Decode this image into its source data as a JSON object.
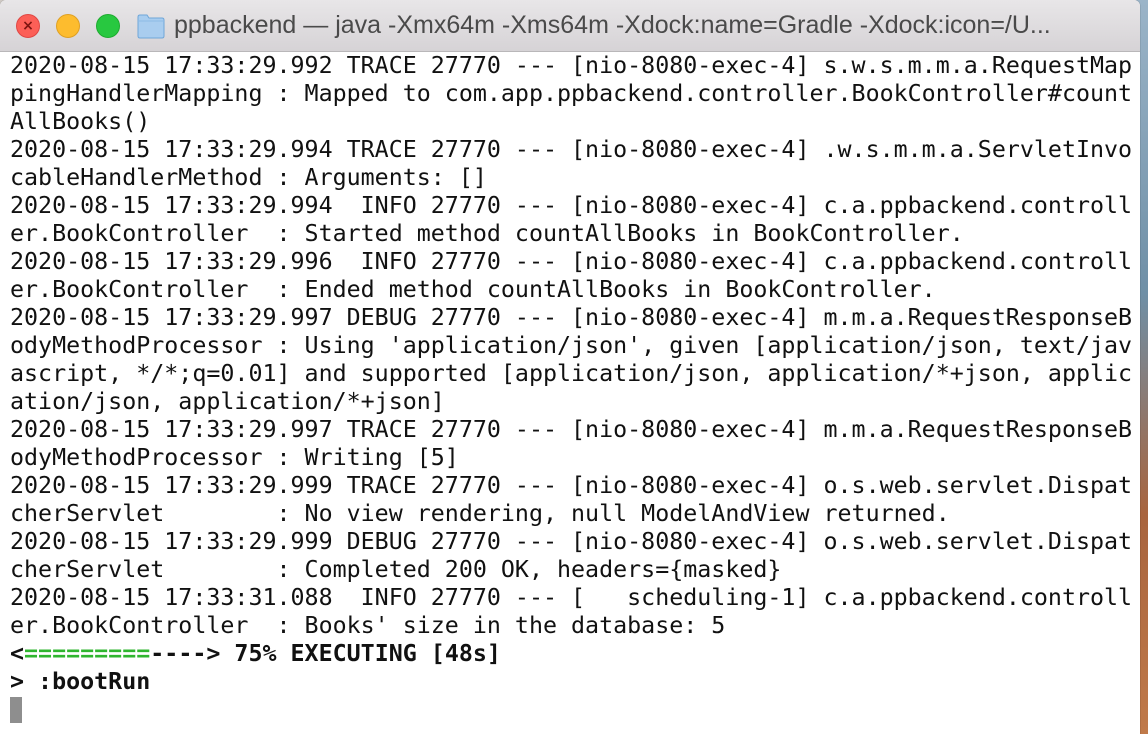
{
  "window": {
    "title": "ppbackend — java -Xmx64m -Xms64m -Xdock:name=Gradle -Xdock:icon=/U..."
  },
  "colors": {
    "progress_done": "#2fb52f",
    "close": "#fc5f57",
    "minimize": "#fdbc2e",
    "maximize": "#28c840"
  },
  "terminal": {
    "lines": [
      "2020-08-15 17:33:29.992 TRACE 27770 --- [nio-8080-exec-4] s.w.s.m.m.a.RequestMap",
      "pingHandlerMapping : Mapped to com.app.ppbackend.controller.BookController#count",
      "AllBooks()",
      "2020-08-15 17:33:29.994 TRACE 27770 --- [nio-8080-exec-4] .w.s.m.m.a.ServletInvo",
      "cableHandlerMethod : Arguments: []",
      "2020-08-15 17:33:29.994  INFO 27770 --- [nio-8080-exec-4] c.a.ppbackend.controll",
      "er.BookController  : Started method countAllBooks in BookController.",
      "2020-08-15 17:33:29.996  INFO 27770 --- [nio-8080-exec-4] c.a.ppbackend.controll",
      "er.BookController  : Ended method countAllBooks in BookController.",
      "2020-08-15 17:33:29.997 DEBUG 27770 --- [nio-8080-exec-4] m.m.a.RequestResponseB",
      "odyMethodProcessor : Using 'application/json', given [application/json, text/jav",
      "ascript, */*;q=0.01] and supported [application/json, application/*+json, applic",
      "ation/json, application/*+json]",
      "2020-08-15 17:33:29.997 TRACE 27770 --- [nio-8080-exec-4] m.m.a.RequestResponseB",
      "odyMethodProcessor : Writing [5]",
      "2020-08-15 17:33:29.999 TRACE 27770 --- [nio-8080-exec-4] o.s.web.servlet.Dispat",
      "cherServlet        : No view rendering, null ModelAndView returned.",
      "2020-08-15 17:33:29.999 DEBUG 27770 --- [nio-8080-exec-4] o.s.web.servlet.Dispat",
      "cherServlet        : Completed 200 OK, headers={masked}",
      "2020-08-15 17:33:31.088  INFO 27770 --- [   scheduling-1] c.a.ppbackend.controll",
      "er.BookController  : Books' size in the database: 5"
    ],
    "progress": {
      "open": "<",
      "done_bar": "=========",
      "remaining_bar": "---->",
      "status": " 75% EXECUTING [48s]"
    },
    "prompt": "> :bootRun"
  }
}
